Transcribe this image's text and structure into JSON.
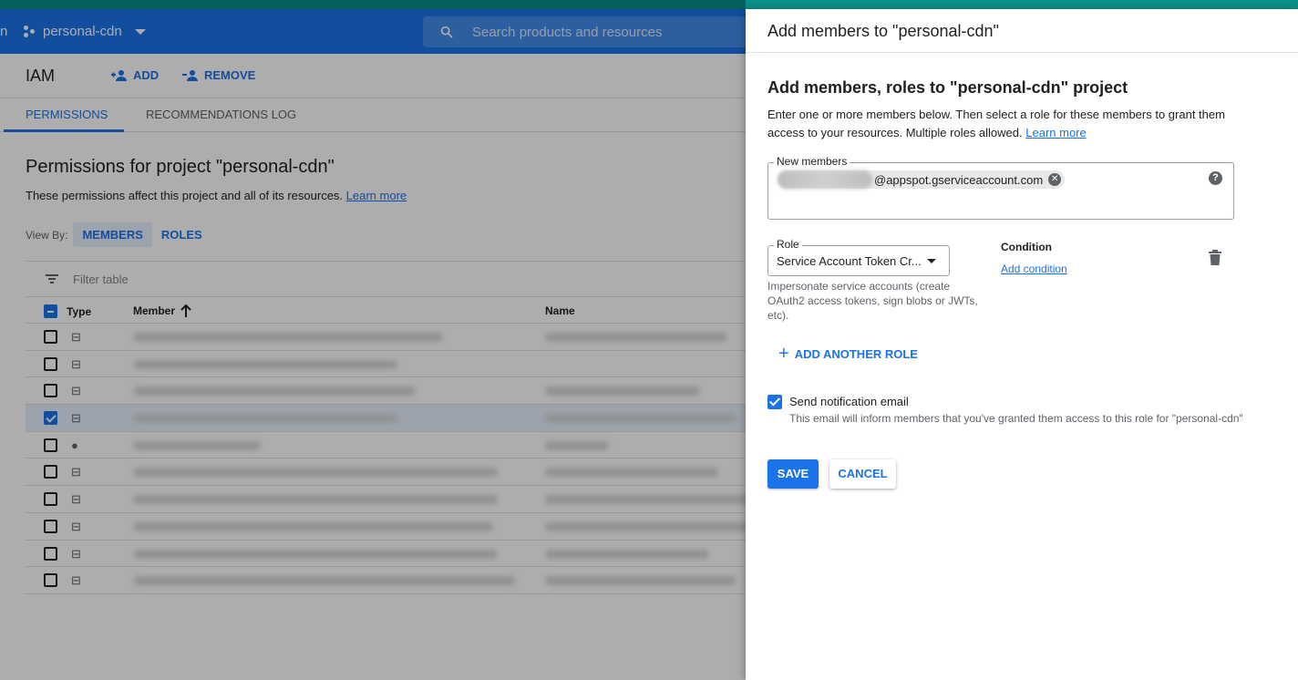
{
  "topbar": {
    "left_edge_text": "n",
    "project_name": "personal-cdn",
    "search_placeholder": "Search products and resources"
  },
  "iam": {
    "title": "IAM",
    "add_label": "ADD",
    "remove_label": "REMOVE"
  },
  "tabs": [
    {
      "label": "PERMISSIONS",
      "active": true
    },
    {
      "label": "RECOMMENDATIONS LOG",
      "active": false
    }
  ],
  "permissions": {
    "title": "Permissions for project \"personal-cdn\"",
    "subtitle": "These permissions affect this project and all of its resources.",
    "learn_more": "Learn more",
    "view_by_label": "View By:",
    "view_members": "MEMBERS",
    "view_roles": "ROLES",
    "filter_placeholder": "Filter table"
  },
  "table": {
    "col_type": "Type",
    "col_member": "Member",
    "col_name": "Name",
    "rows": [
      {
        "icon": "service-account-icon",
        "checked": false
      },
      {
        "icon": "service-account-icon",
        "checked": false
      },
      {
        "icon": "service-account-icon",
        "checked": false
      },
      {
        "icon": "service-account-icon",
        "checked": true
      },
      {
        "icon": "person-icon",
        "checked": false
      },
      {
        "icon": "service-account-icon",
        "checked": false
      },
      {
        "icon": "service-account-icon",
        "checked": false
      },
      {
        "icon": "service-account-icon",
        "checked": false
      },
      {
        "icon": "service-account-icon",
        "checked": false
      },
      {
        "icon": "service-account-icon",
        "checked": false
      }
    ]
  },
  "panel": {
    "title": "Add members to \"personal-cdn\"",
    "heading": "Add members, roles to \"personal-cdn\" project",
    "description": "Enter one or more members below. Then select a role for these members to grant them access to your resources. Multiple roles allowed.",
    "learn_more": "Learn more",
    "new_members_label": "New members",
    "member_chip_suffix": "@appspot.gserviceaccount.com",
    "role_label": "Role",
    "role_value": "Service Account Token Cr...",
    "role_description": "Impersonate service accounts (create OAuth2 access tokens, sign blobs or JWTs, etc).",
    "condition_label": "Condition",
    "add_condition": "Add condition",
    "add_another_role": "ADD ANOTHER ROLE",
    "notify_label": "Send notification email",
    "notify_help": "This email will inform members that you've granted them access to this role for \"personal-cdn\"",
    "notify_checked": true,
    "save_label": "SAVE",
    "cancel_label": "CANCEL"
  },
  "colors": {
    "accent": "#1a73e8",
    "topbar": "#1a73e8",
    "teal": "#0a8f8a"
  }
}
